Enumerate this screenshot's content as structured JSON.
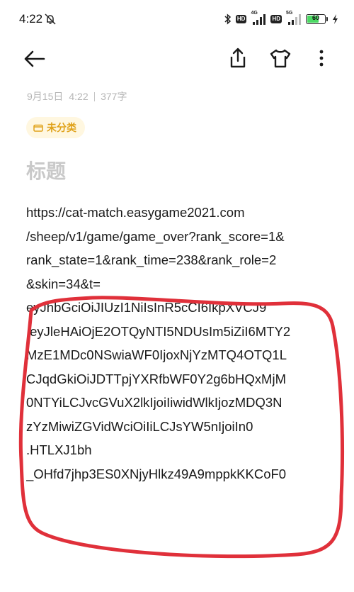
{
  "status_bar": {
    "time": "4:22",
    "network_1": "4G",
    "network_2": "5G",
    "battery_level": "60",
    "icons": [
      "mute-icon",
      "bluetooth-icon",
      "hd-icon",
      "signal-icon",
      "hd-icon",
      "signal-icon",
      "battery-icon",
      "charging-icon"
    ]
  },
  "toolbar": {
    "icons": [
      "back-arrow-icon",
      "share-icon",
      "shirt-icon",
      "more-icon"
    ]
  },
  "note": {
    "meta_date": "9月15日",
    "meta_time": "4:22",
    "meta_count": "377字",
    "category": "未分类",
    "title_placeholder": "标题",
    "lines": [
      "https://cat-match.easygame2021.com",
      "/sheep/v1/game/game_over?rank_score=1&",
      "rank_state=1&rank_time=238&rank_role=2",
      "&skin=34&t=",
      "eyJhbGciOiJIUzI1NiIsInR5cCI6IkpXVCJ9",
      ".eyJleHAiOjE2OTQyNTI5NDUsIm5iZiI6MTY2",
      "MzE1MDc0NSwiaWF0IjoxNjYzMTQ4OTQ1L",
      "CJqdGkiOiJDTTpjYXRfbWF0Y2g6bHQxMjM",
      "0NTYiLCJvcGVuX2lkIjoiIiwidWlkIjozMDQ3N",
      "zYzMiwiZGVidWciOiIiLCJsYW5nIjoiIn0",
      ".HTLXJ1bh",
      "_OHfd7jhp3ES0XNjyHlkz49A9mppkKKCoF0"
    ]
  },
  "colors": {
    "annotation_red": "#e0303a",
    "category_text": "#e0a21a",
    "category_bg": "#fff7e0"
  }
}
